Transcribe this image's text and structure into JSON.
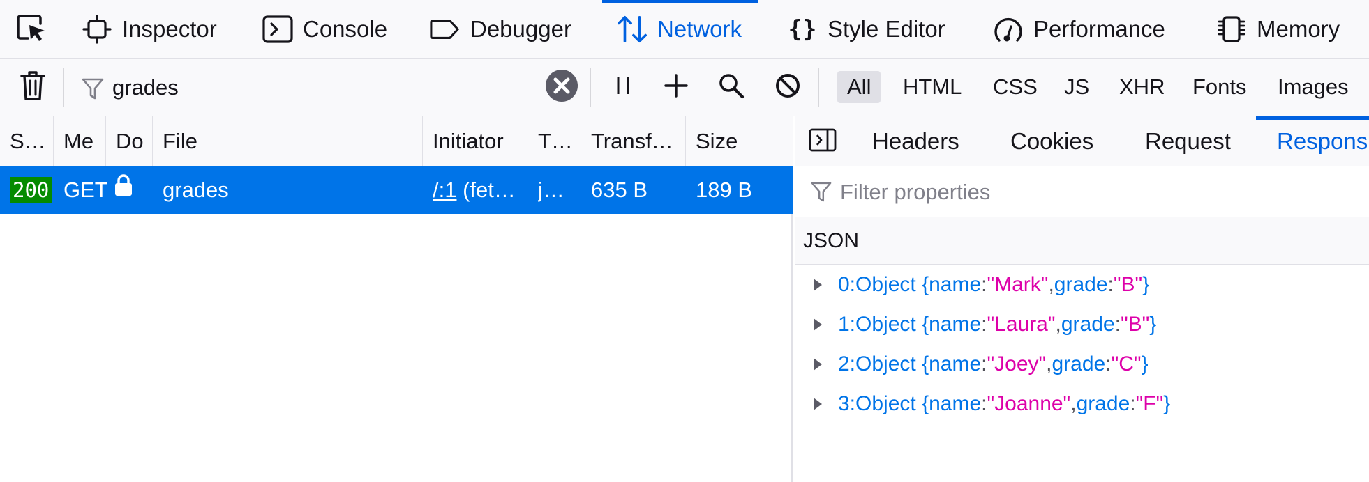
{
  "tabs": [
    {
      "label": "Inspector",
      "icon": "inspector-icon"
    },
    {
      "label": "Console",
      "icon": "console-icon"
    },
    {
      "label": "Debugger",
      "icon": "debugger-icon"
    },
    {
      "label": "Network",
      "icon": "network-icon",
      "active": true
    },
    {
      "label": "Style Editor",
      "icon": "style-editor-icon"
    },
    {
      "label": "Performance",
      "icon": "performance-icon"
    },
    {
      "label": "Memory",
      "icon": "memory-icon"
    }
  ],
  "toolbar": {
    "filter_value": "grades",
    "type_filters": [
      "All",
      "HTML",
      "CSS",
      "JS",
      "XHR",
      "Fonts",
      "Images"
    ],
    "active_type": "All"
  },
  "columns": [
    "S…",
    "Me",
    "Do",
    "File",
    "Initiator",
    "T…",
    "Transf…",
    "Size"
  ],
  "request": {
    "status": "200",
    "method": "GET",
    "file": "grades",
    "initiator_link": "/:1",
    "initiator_rest": " (fet…",
    "type": "j…",
    "transferred": "635 B",
    "size": "189 B"
  },
  "detail_tabs": [
    "Headers",
    "Cookies",
    "Request",
    "Respons"
  ],
  "active_detail_tab": "Respons",
  "filter_properties_placeholder": "Filter properties",
  "json_section_label": "JSON",
  "json_rows": [
    {
      "index": "0",
      "name": "Mark",
      "grade": "B"
    },
    {
      "index": "1",
      "name": "Laura",
      "grade": "B"
    },
    {
      "index": "2",
      "name": "Joey",
      "grade": "C"
    },
    {
      "index": "3",
      "name": "Joanne",
      "grade": "F"
    }
  ],
  "json_text": {
    "object_word": "Object",
    "open_brace": "{",
    "close_brace": "}",
    "name_key": "name",
    "grade_key": "grade",
    "colon": ":",
    "comma": ","
  },
  "colors": {
    "accent": "#0061e0",
    "selected_row": "#0074e8",
    "status_ok": "#058b00",
    "json_key": "#0074e8",
    "json_string": "#dd00a9"
  }
}
